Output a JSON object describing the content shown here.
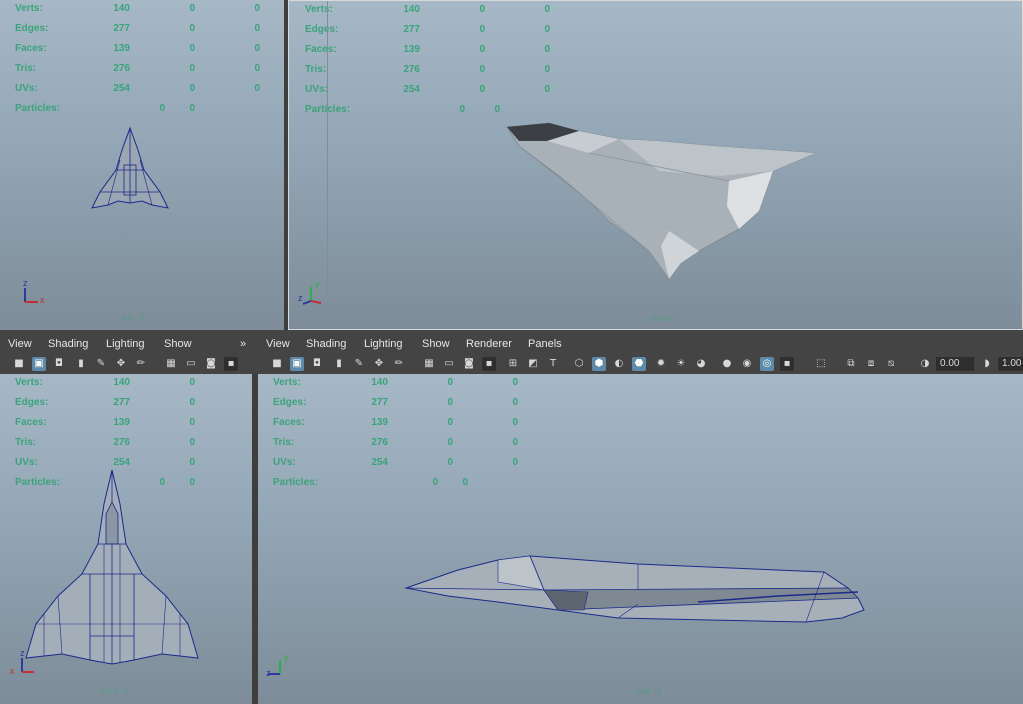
{
  "stats_labels": [
    "Verts:",
    "Edges:",
    "Faces:",
    "Tris:",
    "UVs:",
    "Particles:"
  ],
  "stats": {
    "top": [
      [
        "140",
        "0",
        "0"
      ],
      [
        "277",
        "0",
        "0"
      ],
      [
        "139",
        "0",
        "0"
      ],
      [
        "276",
        "0",
        "0"
      ],
      [
        "254",
        "0",
        "0"
      ],
      [
        "0",
        "0"
      ]
    ],
    "persp": [
      [
        "140",
        "0",
        "0"
      ],
      [
        "277",
        "0",
        "0"
      ],
      [
        "139",
        "0",
        "0"
      ],
      [
        "276",
        "0",
        "0"
      ],
      [
        "254",
        "0",
        "0"
      ],
      [
        "0",
        "0"
      ]
    ],
    "front": [
      [
        "140",
        "0"
      ],
      [
        "277",
        "0"
      ],
      [
        "139",
        "0"
      ],
      [
        "276",
        "0"
      ],
      [
        "254",
        "0"
      ],
      [
        "0",
        "0"
      ]
    ],
    "side": [
      [
        "140",
        "0",
        "0"
      ],
      [
        "277",
        "0",
        "0"
      ],
      [
        "139",
        "0",
        "0"
      ],
      [
        "276",
        "0",
        "0"
      ],
      [
        "254",
        "0",
        "0"
      ],
      [
        "0",
        "0"
      ]
    ]
  },
  "cameras": {
    "top": "top -Y",
    "persp": "persp",
    "front": "front -Y",
    "side": "side -X"
  },
  "panel_menu_left": {
    "view": "View",
    "shading": "Shading",
    "lighting": "Lighting",
    "show": "Show",
    "more": "»"
  },
  "panel_menu_right": {
    "view": "View",
    "shading": "Shading",
    "lighting": "Lighting",
    "show": "Show",
    "renderer": "Renderer",
    "panels": "Panels"
  },
  "toolbar_fields": {
    "field1": "0.00",
    "field2": "1.00"
  },
  "axis_labels": {
    "x": "x",
    "y": "y",
    "z": "z"
  },
  "colors": {
    "stats_text": "#3aa37a",
    "wire": "#1a2a8a",
    "mesh": "#a7aeb5",
    "active_icon": "#5d8aa8"
  }
}
